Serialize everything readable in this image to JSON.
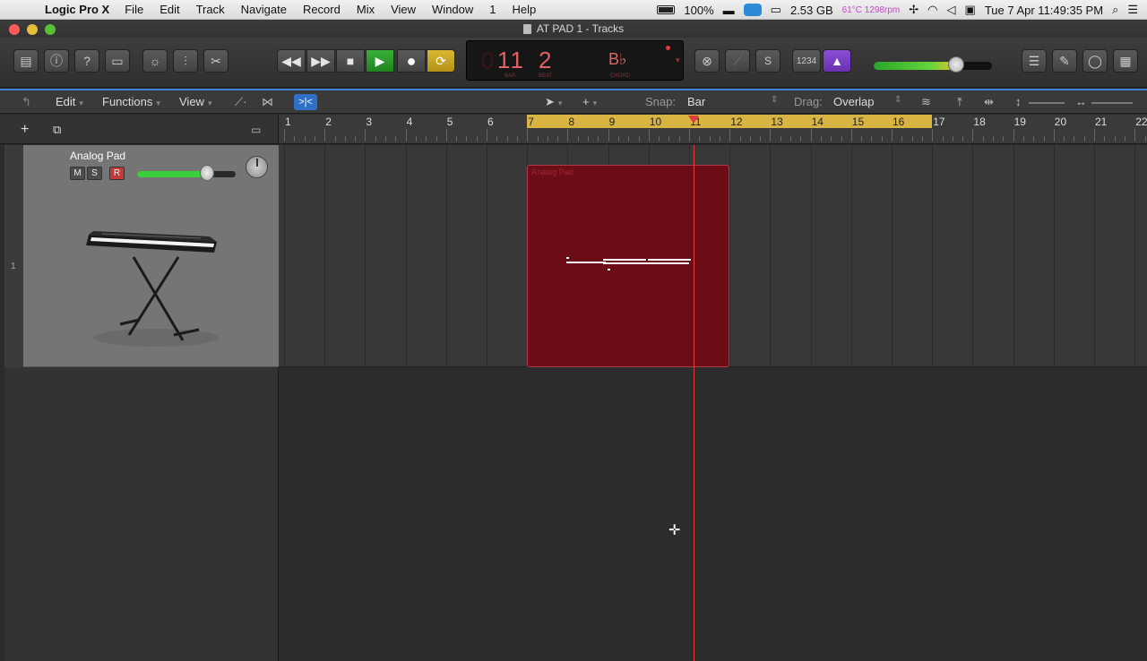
{
  "menubar": {
    "app_name": "Logic Pro X",
    "items": [
      "File",
      "Edit",
      "Track",
      "Navigate",
      "Record",
      "Mix",
      "View",
      "Window",
      "1",
      "Help"
    ],
    "battery": "100%",
    "memory": "2.53 GB",
    "temp": "61°C 1298rpm",
    "datetime": "Tue 7 Apr  11:49:35 PM"
  },
  "window": {
    "title": "AT PAD 1 - Tracks"
  },
  "lcd": {
    "bar": "11",
    "bar_ghost": "0",
    "beat": "2",
    "bar_label": "BAR",
    "beat_label": "BEAT",
    "chord": "B♭",
    "chord_label": "CHORD"
  },
  "controlbar": {
    "count_in": "1234",
    "master_volume_fraction": 0.68
  },
  "trackbar": {
    "edit": "Edit",
    "functions": "Functions",
    "view": "View",
    "snap_label": "Snap:",
    "snap_value": "Bar",
    "drag_label": "Drag:",
    "drag_value": "Overlap"
  },
  "ruler": {
    "bars": [
      "1",
      "2",
      "3",
      "4",
      "5",
      "6",
      "7",
      "8",
      "9",
      "10",
      "11",
      "12",
      "13",
      "14",
      "15",
      "16",
      "17",
      "18",
      "19",
      "20",
      "21",
      "22"
    ],
    "cycle_start_bar": 7,
    "cycle_end_bar": 17,
    "playhead_bar": 11.1
  },
  "track": {
    "number": "1",
    "name": "Analog Pad",
    "mute": "M",
    "solo": "S",
    "record": "R",
    "volume_fraction": 0.72,
    "region_name": "Analog Pad",
    "region_start_bar": 7,
    "region_end_bar": 12
  }
}
